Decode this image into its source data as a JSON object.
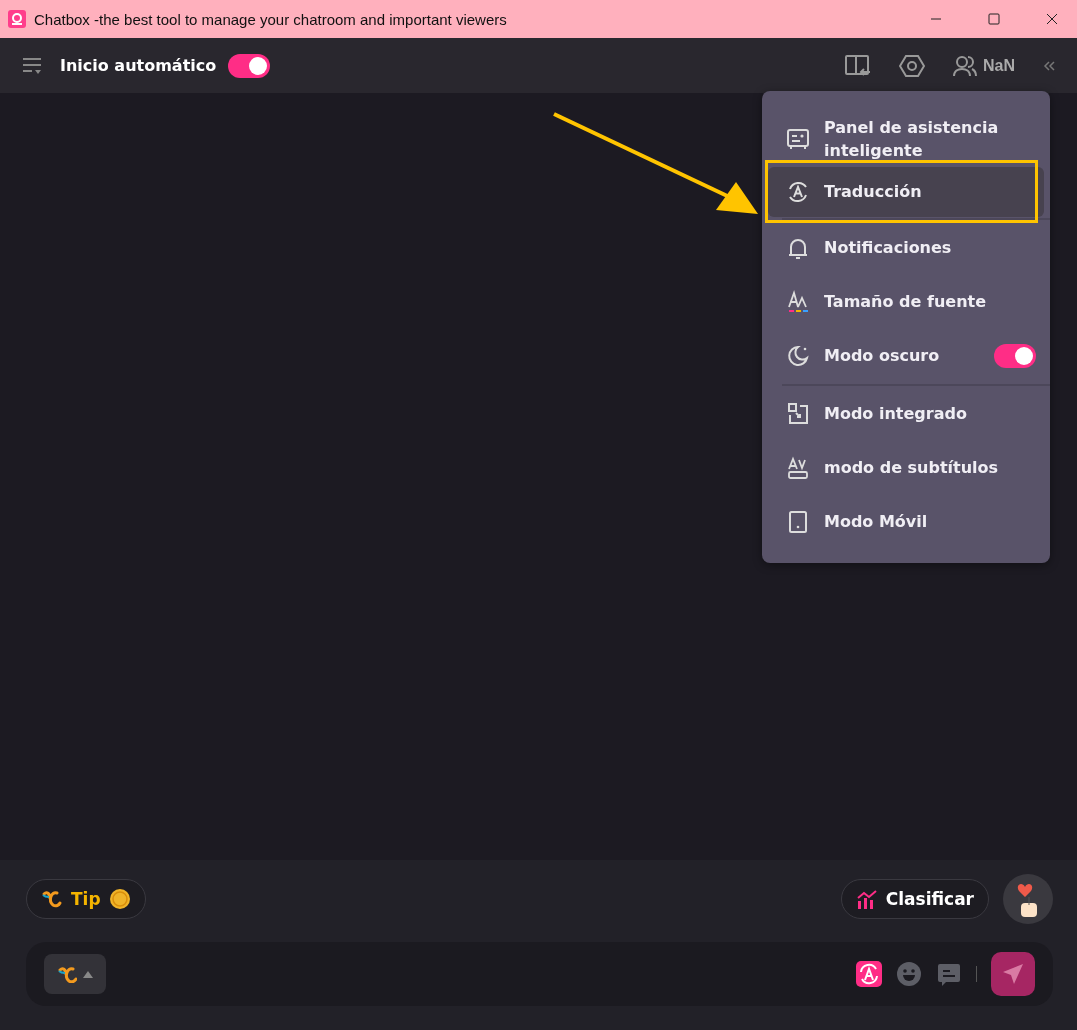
{
  "window": {
    "title": "Chatbox -the best tool to manage your chatroom and important viewers"
  },
  "toolbar": {
    "auto_start": {
      "label": "Inicio automático",
      "on": true
    },
    "viewers": "NaN"
  },
  "menu": {
    "items": [
      {
        "kind": "item",
        "label": "Panel de asistencia inteligente",
        "selected": false,
        "divider_after": false
      },
      {
        "kind": "item",
        "label": "Traducción",
        "selected": true,
        "divider_after": true
      },
      {
        "kind": "item",
        "label": "Notificaciones",
        "selected": false,
        "divider_after": false
      },
      {
        "kind": "item",
        "label": "Tamaño de fuente",
        "selected": false,
        "divider_after": false
      },
      {
        "kind": "toggle",
        "label": "Modo oscuro",
        "selected": false,
        "on": true,
        "divider_after": true
      },
      {
        "kind": "item",
        "label": "Modo integrado",
        "selected": false,
        "divider_after": false
      },
      {
        "kind": "item",
        "label": "modo de subtítulos",
        "selected": false,
        "divider_after": false
      },
      {
        "kind": "item",
        "label": "Modo Móvil",
        "selected": false,
        "divider_after": false
      }
    ]
  },
  "bottom": {
    "tip": "Tip",
    "rank": "Clasificar"
  }
}
